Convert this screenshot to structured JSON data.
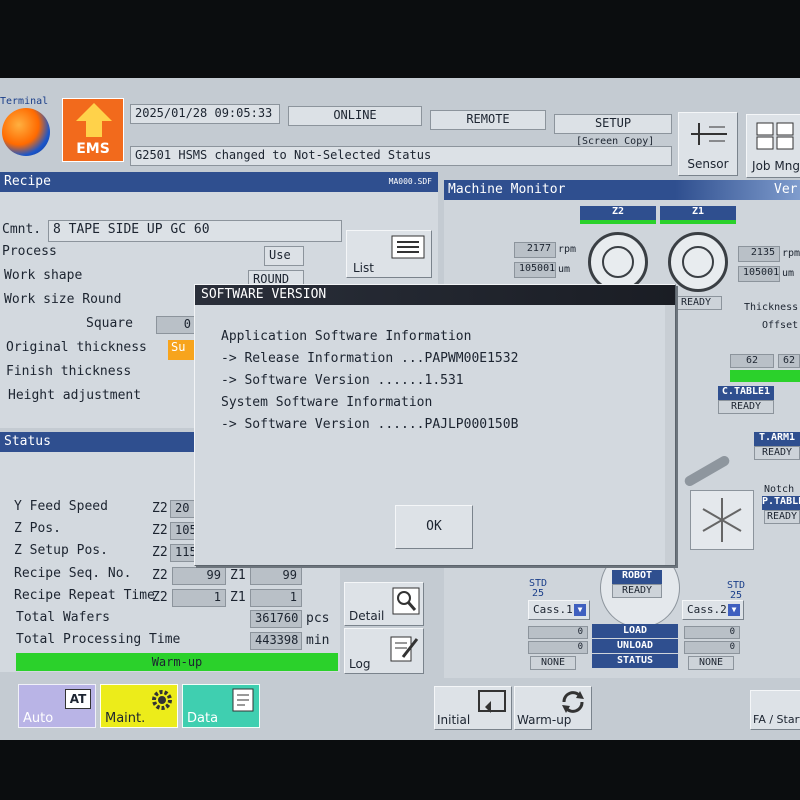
{
  "top": {
    "terminal": "Terminal",
    "ems": "EMS",
    "datetime": "2025/01/28 09:05:33",
    "online": "ONLINE",
    "remote": "REMOTE",
    "setup": "SETUP",
    "screen_copy": "[Screen Copy]",
    "message": "G2501  HSMS changed to Not-Selected Status",
    "sensor": "Sensor",
    "job_mng": "Job Mng"
  },
  "recipe": {
    "title": "Recipe",
    "file": "MA000.SDF",
    "comment_label": "Cmnt.",
    "comment_value": "8 TAPE SIDE UP GC  60",
    "process_label": "Process",
    "process_value": "Use",
    "work_shape_label": "Work shape",
    "work_shape_value": "ROUND",
    "work_size_label": "Work size Round",
    "square_label": "Square",
    "square_value": "0",
    "orig_thick_label": "Original thickness",
    "orig_thick_value": "Su",
    "finish_thick_label": "Finish thickness",
    "height_adj_label": "Height adjustment",
    "list_button": "List"
  },
  "status": {
    "title": "Status",
    "y_feed_label": "Y Feed Speed",
    "z_pos_label": "Z Pos.",
    "z_setup_label": "Z Setup Pos.",
    "recipe_seq_label": "Recipe Seq. No.",
    "recipe_repeat_label": "Recipe Repeat Time",
    "z2": "Z2",
    "z1": "Z1",
    "y_feed_z2": "20",
    "z_pos_z2": "105",
    "z_setup_z2": "115",
    "seq_z2": "99",
    "seq_z1": "99",
    "repeat_z2": "1",
    "repeat_z1": "1",
    "total_wafers_label": "Total Wafers",
    "total_wafers_value": "361760",
    "total_wafers_unit": "pcs",
    "total_time_label": "Total Processing Time",
    "total_time_value": "443398",
    "total_time_unit": "min",
    "warmup_bar": "Warm-up",
    "detail_button": "Detail",
    "log_button": "Log"
  },
  "monitor": {
    "title": "Machine Monitor",
    "ver": "Ver.",
    "z2": "Z2",
    "z1": "Z1",
    "z2_rpm": "2177",
    "z2_um": "105001",
    "z1_rpm": "2135",
    "z1_um": "105001",
    "rpm_unit": "rpm",
    "um_unit": "um",
    "ready": "READY",
    "thickness": "Thickness",
    "offset": "Offset",
    "gauge_a": "62",
    "gauge_b": "62",
    "ctable1": "C.TABLE1",
    "tarm1": "T.ARM1",
    "notch": "Notch",
    "ptable": "P.TABLE",
    "robot": "ROBOT",
    "std_label": "STD",
    "std_left": "25",
    "std_right": "25",
    "cass1": "Cass.1",
    "cass2": "Cass.2",
    "cass_val": "0",
    "none": "NONE",
    "load": "LOAD",
    "unload": "UNLOAD",
    "status": "STATUS"
  },
  "bottom": {
    "auto": "Auto",
    "auto_badge": "AT",
    "maint": "Maint.",
    "data": "Data",
    "initial": "Initial",
    "warmup": "Warm-up",
    "fa_start": "FA / Start"
  },
  "dialog": {
    "title": "SOFTWARE VERSION",
    "line1": "Application Software Information",
    "line2": "-> Release Information ...PAPWM00E1532",
    "line3": "-> Software Version ......1.531",
    "line4": "System Software Information",
    "line5": "-> Software Version ......PAJLP000150B",
    "ok": "OK"
  },
  "colors": {
    "header_blue": "#2f4f8f",
    "ems_orange": "#f26a1c",
    "warmup_green": "#2bd12b",
    "maint_yellow": "#ecec1a",
    "data_teal": "#3fcfb0",
    "auto_lilac": "#b9b4e6"
  }
}
